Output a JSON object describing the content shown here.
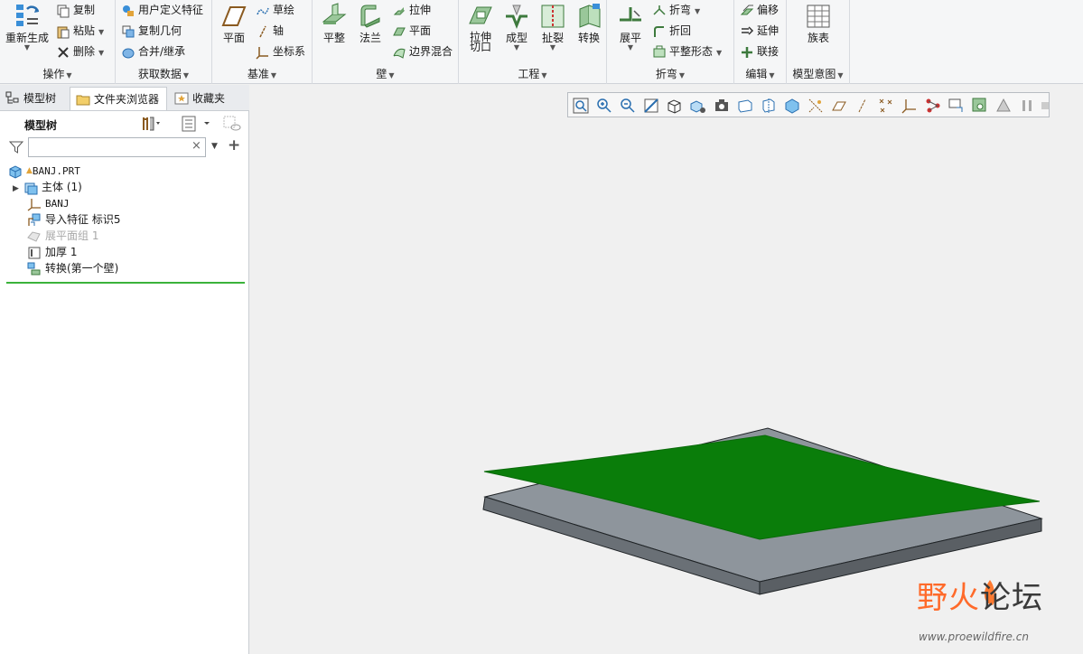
{
  "ribbon": {
    "groups": {
      "operations": {
        "label": "操作",
        "regen": "重新生成",
        "copy": "复制",
        "paste": "粘贴",
        "delete": "删除"
      },
      "get_data": {
        "label": "获取数据",
        "udf": "用户定义特征",
        "copy_geom": "复制几何",
        "merge": "合并/继承"
      },
      "datum": {
        "label": "基准",
        "plane": "平面",
        "sketch": "草绘",
        "axis": "轴",
        "csys": "坐标系"
      },
      "wall": {
        "label": "壁",
        "flat": "平整",
        "flange": "法兰",
        "extrude": "拉伸",
        "planar": "平面",
        "blend": "边界混合"
      },
      "engineering": {
        "label": "工程",
        "extrude_cut_1": "拉伸",
        "extrude_cut_2": "切口",
        "form": "成型",
        "rip": "扯裂",
        "convert": "转换"
      },
      "bends": {
        "label": "折弯",
        "unbend": "展平",
        "bend": "折弯",
        "bend_back": "折回",
        "flat_form": "平整形态"
      },
      "editing": {
        "label": "编辑",
        "offset": "偏移",
        "extend": "延伸",
        "join": "联接"
      },
      "model_intent": {
        "label": "模型意图",
        "family_table": "族表"
      }
    }
  },
  "left_tabs": {
    "model_tree": "模型树",
    "folder_browser": "文件夹浏览器",
    "favorites": "收藏夹"
  },
  "tree": {
    "title": "模型树",
    "filter_placeholder": "",
    "items": [
      {
        "label": "BANJ.PRT",
        "icon": "part-icon"
      },
      {
        "label": "主体 (1)",
        "icon": "body-icon"
      },
      {
        "label": "BANJ",
        "icon": "csys-icon"
      },
      {
        "label": "导入特征 标识5",
        "icon": "import-icon"
      },
      {
        "label": "展平面组 1",
        "icon": "flat-quilt-icon"
      },
      {
        "label": "加厚 1",
        "icon": "thicken-icon"
      },
      {
        "label": "转换(第一个壁)",
        "icon": "convert-icon"
      }
    ]
  },
  "watermark": {
    "title_part1": "野火",
    "title_part2": "论坛",
    "url": "www.proewildfire.cn"
  },
  "colors": {
    "surface": "#0a7d0a",
    "plate_top": "#8e959c",
    "plate_side": "#5f656b",
    "accent_line": "#3bb33b"
  }
}
